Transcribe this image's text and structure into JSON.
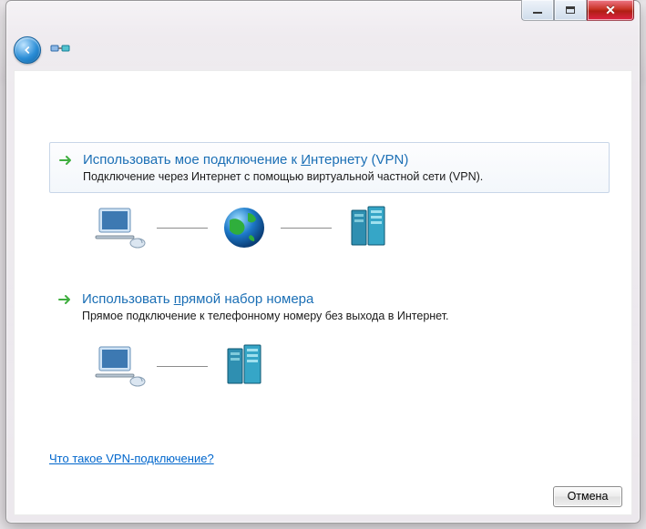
{
  "options": {
    "vpn": {
      "title_pre": "Использовать мое подключение к ",
      "title_accel": "И",
      "title_post": "нтернету (VPN)",
      "desc": "Подключение через Интернет с помощью виртуальной частной сети (VPN)."
    },
    "dialup": {
      "title_pre": "Использовать ",
      "title_accel": "п",
      "title_post": "рямой набор номера",
      "desc": "Прямое подключение к телефонному номеру без выхода в Интернет."
    }
  },
  "help_link": "Что такое VPN-подключение?",
  "buttons": {
    "cancel": "Отмена"
  }
}
